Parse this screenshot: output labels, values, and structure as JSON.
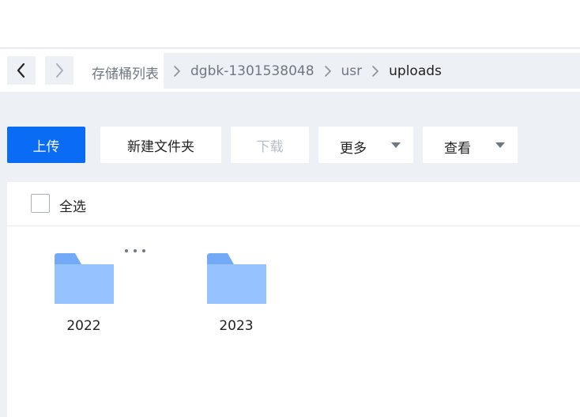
{
  "breadcrumb": {
    "items": [
      "存储桶列表",
      "dgbk-1301538048",
      "usr",
      "uploads"
    ]
  },
  "toolbar": {
    "upload_label": "上传",
    "new_folder_label": "新建文件夹",
    "download_label": "下载",
    "more_label": "更多",
    "view_label": "查看"
  },
  "list": {
    "select_all_label": "全选"
  },
  "folders": [
    {
      "name": "2022"
    },
    {
      "name": "2023"
    }
  ],
  "colors": {
    "accent": "#0a6cf5",
    "folder": "#96c2ff",
    "folder_tab": "#72aaf7",
    "background": "#edf0f5"
  }
}
